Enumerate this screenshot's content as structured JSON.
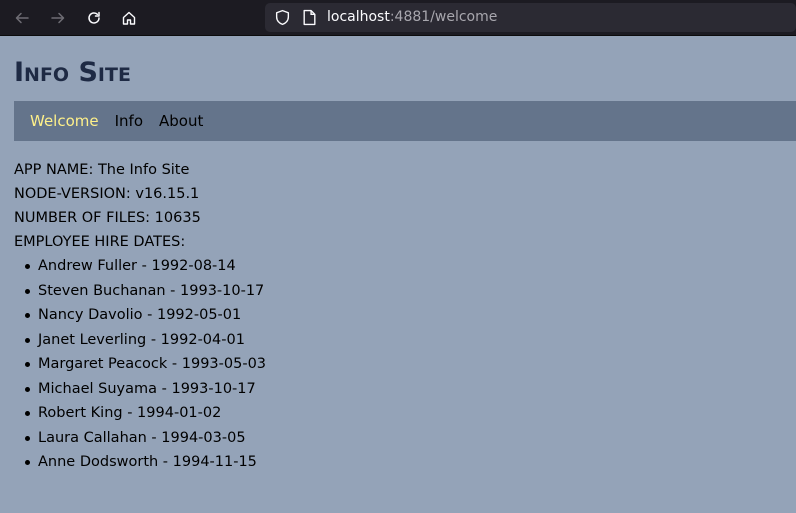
{
  "browser": {
    "url_host": "localhost",
    "url_rest": ":4881/welcome"
  },
  "site": {
    "title": "Info Site"
  },
  "nav": {
    "items": [
      {
        "label": "Welcome"
      },
      {
        "label": "Info"
      },
      {
        "label": "About"
      }
    ],
    "active": "Welcome"
  },
  "info": {
    "app_name": "APP NAME: The Info Site",
    "node_version": "NODE-VERSION: v16.15.1",
    "number_of_files": "NUMBER OF FILES: 10635",
    "hire_dates_heading": "EMPLOYEE HIRE DATES:"
  },
  "employees": [
    "Andrew Fuller - 1992-08-14",
    "Steven Buchanan - 1993-10-17",
    "Nancy Davolio - 1992-05-01",
    "Janet Leverling - 1992-04-01",
    "Margaret Peacock - 1993-05-03",
    "Michael Suyama - 1993-10-17",
    "Robert King - 1994-01-02",
    "Laura Callahan - 1994-03-05",
    "Anne Dodsworth - 1994-11-15"
  ],
  "colors": {
    "page_background": "#94a3b8",
    "navbar_background": "#64748b",
    "active_nav": "#fef08a",
    "title": "#1e2a44"
  }
}
